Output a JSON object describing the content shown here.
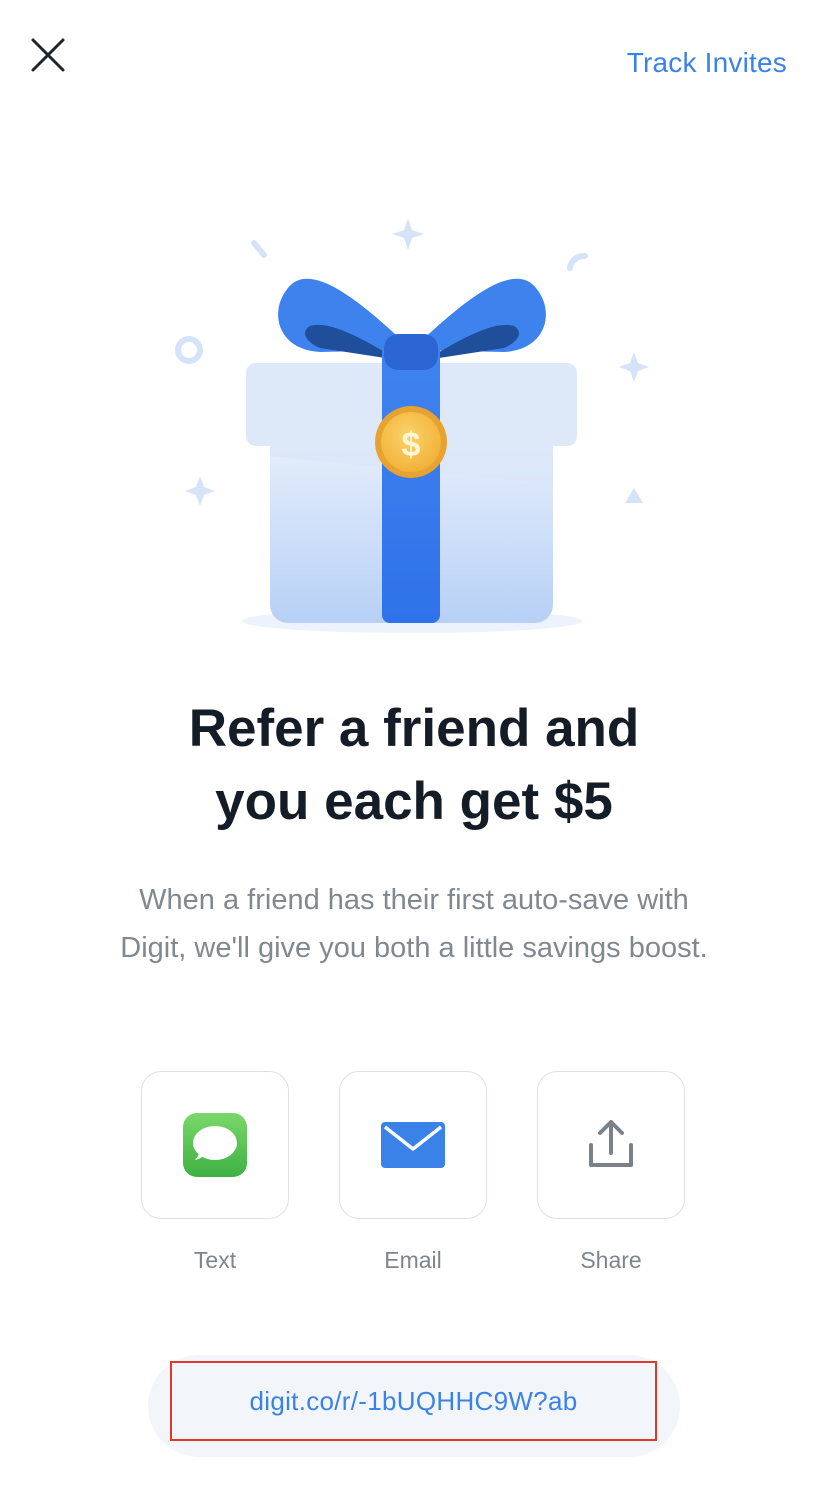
{
  "header": {
    "close_icon": "close-icon",
    "track_invites_label": "Track Invites"
  },
  "hero": {
    "illustration_icon": "gift-box-with-coin-icon"
  },
  "content": {
    "title_line1": "Refer a friend and",
    "title_line2": "you each get $5",
    "subtitle_line1": "When a friend has their first auto-save with",
    "subtitle_line2": "Digit, we'll give you both a little savings boost."
  },
  "share_options": [
    {
      "label": "Text",
      "icon": "messages-icon"
    },
    {
      "label": "Email",
      "icon": "mail-icon"
    },
    {
      "label": "Share",
      "icon": "share-icon"
    }
  ],
  "referral": {
    "link": "digit.co/r/-1bUQHHC9W?ab"
  },
  "colors": {
    "accent": "#3b82e8",
    "title": "#141c27",
    "muted_text": "#808890",
    "highlight_border": "#e0382c"
  }
}
